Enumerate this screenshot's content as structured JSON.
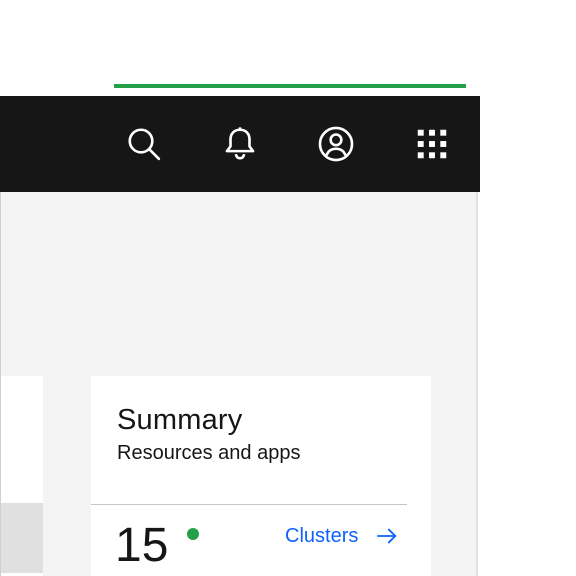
{
  "header": {
    "icons": [
      "search-icon",
      "bell-icon",
      "user-avatar-icon",
      "app-switcher-icon"
    ]
  },
  "summary": {
    "title": "Summary",
    "subtitle": "Resources and apps",
    "metric": {
      "value": "15",
      "status_color": "#24a148"
    },
    "link_label": "Clusters",
    "link_icon": "arrow-right-icon"
  },
  "colors": {
    "progress": "#24a148",
    "header_bg": "#161616",
    "content_bg": "#f4f4f4",
    "link": "#0f62fe",
    "card_bg": "#ffffff"
  }
}
